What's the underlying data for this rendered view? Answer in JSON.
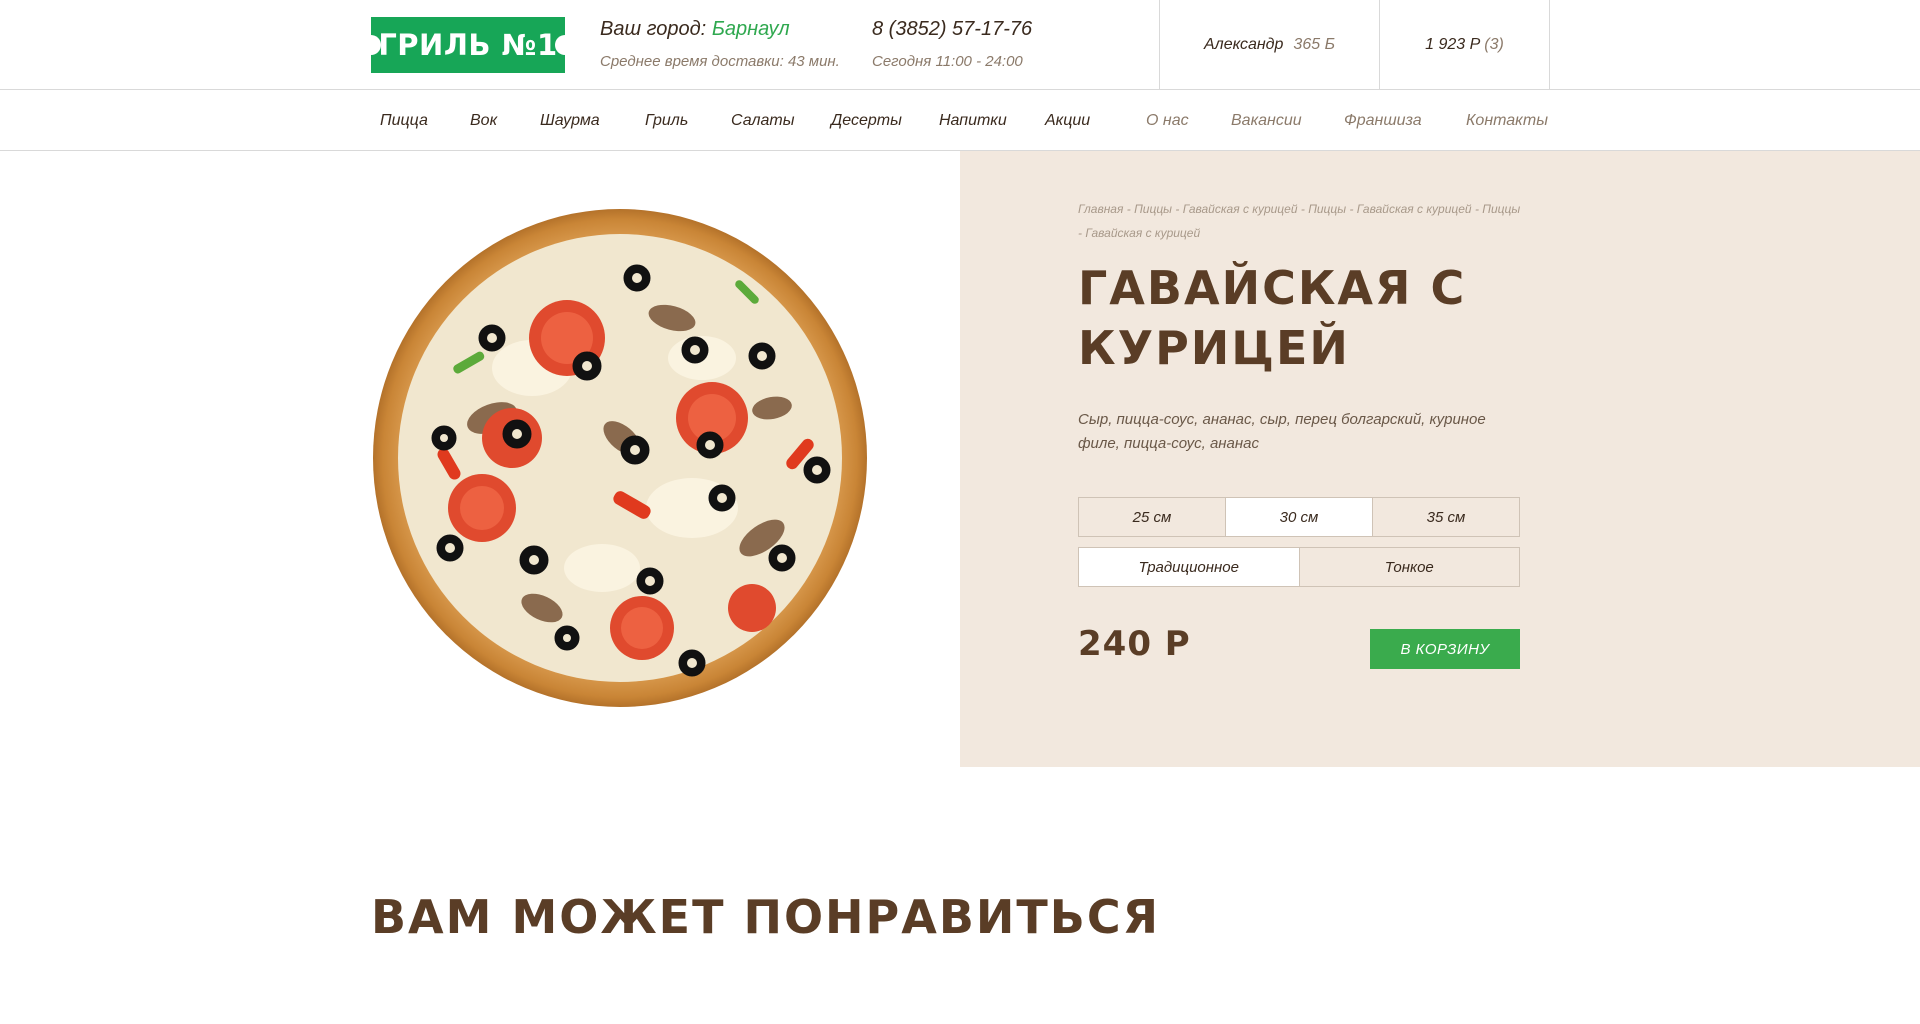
{
  "header": {
    "logo_text": "ГРИЛЬ №1",
    "city_label": "Ваш город:",
    "city_name": "Барнаул",
    "delivery_time": "Среднее время доставки: 43 мин.",
    "phone": "8 (3852) 57-17-76",
    "hours": "Сегодня 11:00 - 24:00",
    "user_name": "Александр",
    "user_points": "365 Б",
    "cart_total": "1 923 Р",
    "cart_count": "(3)"
  },
  "nav": {
    "items": [
      "Пицца",
      "Вок",
      "Шаурма",
      "Гриль",
      "Салаты",
      "Десерты",
      "Напитки",
      "Акции",
      "О нас",
      "Вакансии",
      "Франшиза",
      "Контакты"
    ]
  },
  "breadcrumbs": [
    "Главная",
    "Пиццы",
    "Гавайская с курицей",
    "Пиццы",
    "Гавайская с курицей",
    "Пиццы",
    "Гавайская с курицей"
  ],
  "product": {
    "title": "Гавайская с курицей",
    "description": "Сыр, пицца-соус, ананас, сыр, перец болгарский, куриное филе, пицца-соус, ананас",
    "sizes": [
      "25 см",
      "30 см",
      "35 см"
    ],
    "selected_size": "30 см",
    "crusts": [
      "Традиционное",
      "Тонкое"
    ],
    "selected_crust": "Традиционное",
    "price": "240 Р",
    "cart_button": "В КОРЗИНУ"
  },
  "recommend_title": "ВАМ МОЖЕТ ПОНРАВИТЬСЯ",
  "colors": {
    "brand_green": "#17a657",
    "button_green": "#3aab4d",
    "panel_beige": "#f2e8de",
    "title_brown": "#5a3d26"
  },
  "icons": {
    "product_image": "pizza-image"
  }
}
